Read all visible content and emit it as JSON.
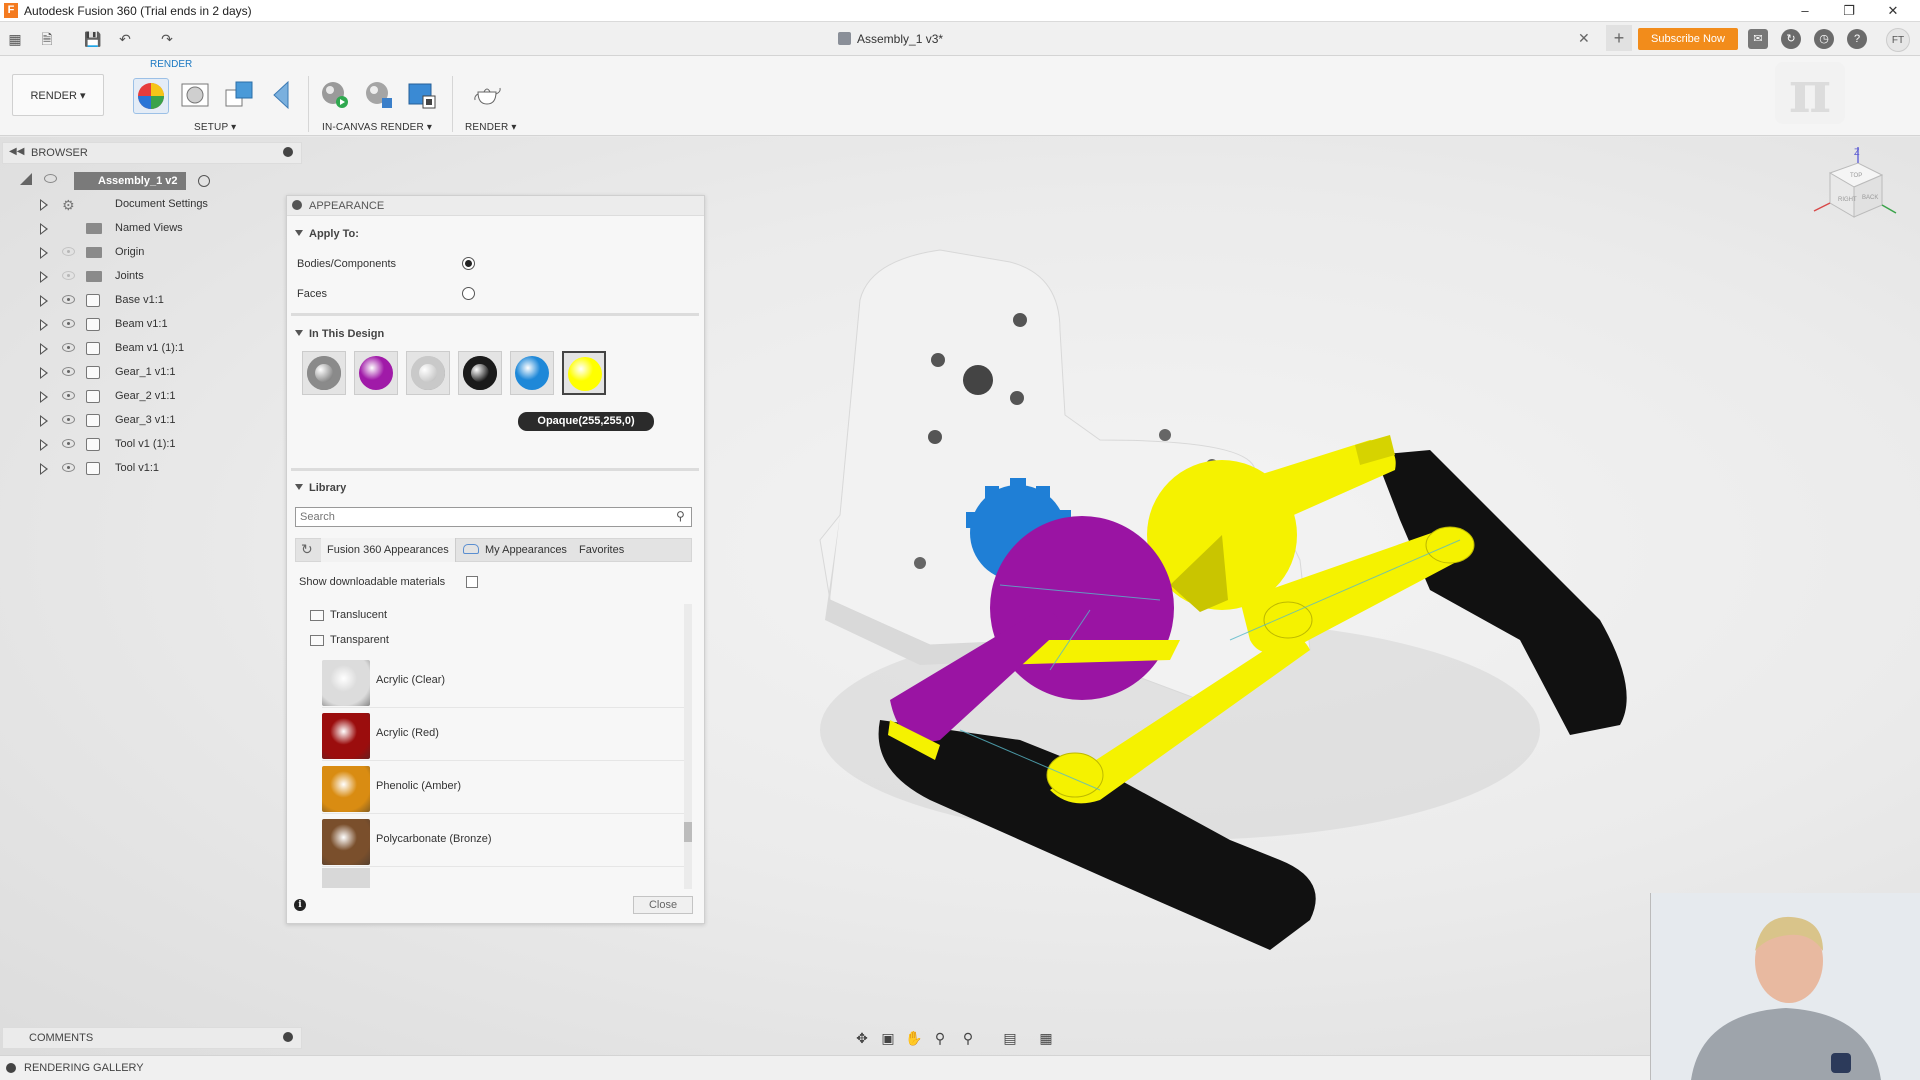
{
  "window": {
    "title": "Autodesk Fusion 360 (Trial ends in 2 days)",
    "logo_letter": "F"
  },
  "toolbar": {
    "document_tab": "Assembly_1 v3*",
    "subscribe": "Subscribe Now",
    "user_initials": "FT"
  },
  "ribbon": {
    "workspace_tab": "RENDER",
    "workspace_button": "RENDER",
    "groups": {
      "setup": "SETUP",
      "in_canvas_render": "IN-CANVAS RENDER",
      "render": "RENDER"
    }
  },
  "browser": {
    "title": "BROWSER",
    "root": "Assembly_1 v2",
    "items": [
      {
        "label": "Document Settings",
        "type": "settings"
      },
      {
        "label": "Named Views",
        "type": "folder"
      },
      {
        "label": "Origin",
        "type": "folder"
      },
      {
        "label": "Joints",
        "type": "folder"
      },
      {
        "label": "Base v1:1",
        "type": "component"
      },
      {
        "label": "Beam v1:1",
        "type": "component"
      },
      {
        "label": "Beam v1 (1):1",
        "type": "component"
      },
      {
        "label": "Gear_1 v1:1",
        "type": "component"
      },
      {
        "label": "Gear_2 v1:1",
        "type": "component"
      },
      {
        "label": "Gear_3 v1:1",
        "type": "component"
      },
      {
        "label": "Tool v1 (1):1",
        "type": "component"
      },
      {
        "label": "Tool v1:1",
        "type": "component"
      }
    ]
  },
  "appearance": {
    "title": "APPEARANCE",
    "apply_to": {
      "heading": "Apply To:",
      "options": [
        {
          "label": "Bodies/Components",
          "selected": true
        },
        {
          "label": "Faces",
          "selected": false
        }
      ]
    },
    "in_this_design": {
      "heading": "In This Design",
      "swatches": [
        {
          "name": "gray-ring",
          "color": "#8a8a8a"
        },
        {
          "name": "purple",
          "color": "#a01aa8"
        },
        {
          "name": "light-gray",
          "color": "#c9c9c9"
        },
        {
          "name": "black",
          "color": "#1a1a1a"
        },
        {
          "name": "blue",
          "color": "#1e88d8"
        },
        {
          "name": "yellow",
          "color": "#ffff00"
        }
      ],
      "tooltip": "Opaque(255,255,0)"
    },
    "library": {
      "heading": "Library",
      "search_placeholder": "Search",
      "tabs": [
        "Fusion 360 Appearances",
        "My Appearances",
        "Favorites"
      ],
      "show_downloadable": "Show downloadable materials",
      "folders": [
        "Translucent",
        "Transparent"
      ],
      "materials": [
        {
          "name": "Acrylic (Clear)",
          "color": "#dcdcdc"
        },
        {
          "name": "Acrylic (Red)",
          "color": "#9b0d0d"
        },
        {
          "name": "Phenolic (Amber)",
          "color": "#d98c12"
        },
        {
          "name": "Polycarbonate (Bronze)",
          "color": "#7a4f2c"
        }
      ]
    },
    "close": "Close",
    "info": "i"
  },
  "viewcube": {
    "axis_z": "Z",
    "faces": [
      "TOP",
      "RIGHT",
      "BACK"
    ]
  },
  "panels": {
    "comments": "COMMENTS",
    "rendering_gallery": "RENDERING GALLERY"
  },
  "scene_colors": {
    "yellow": "#f5f200",
    "purple": "#9a14a3",
    "blue": "#1f7fd6",
    "black": "#111111",
    "white": "#f2f2f2"
  }
}
